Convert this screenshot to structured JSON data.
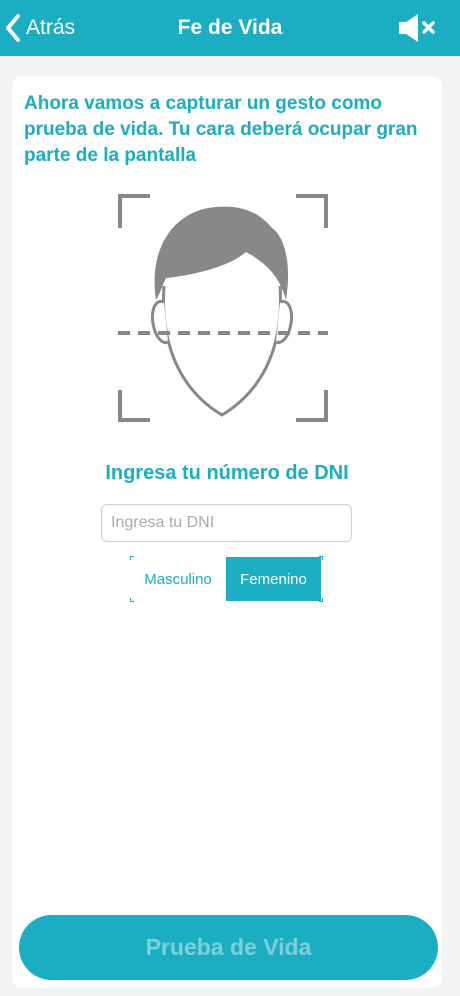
{
  "header": {
    "back_label": "Atrás",
    "title": "Fe de Vida",
    "mute_icon": "speaker-muted-icon"
  },
  "main": {
    "instruction": "Ahora vamos a capturar un gesto como prueba de vida. Tu cara deberá ocupar gran parte de la pantalla",
    "dni_title": "Ingresa tu número de DNI",
    "dni_input": {
      "value": "",
      "placeholder": "Ingresa tu DNI"
    },
    "gender": {
      "options": [
        "Masculino",
        "Femenino"
      ],
      "selected": "Femenino"
    }
  },
  "footer": {
    "cta_label": "Prueba de Vida"
  },
  "colors": {
    "accent": "#1badc2",
    "face_gray": "#8a8787",
    "background": "#f3f3f3"
  }
}
